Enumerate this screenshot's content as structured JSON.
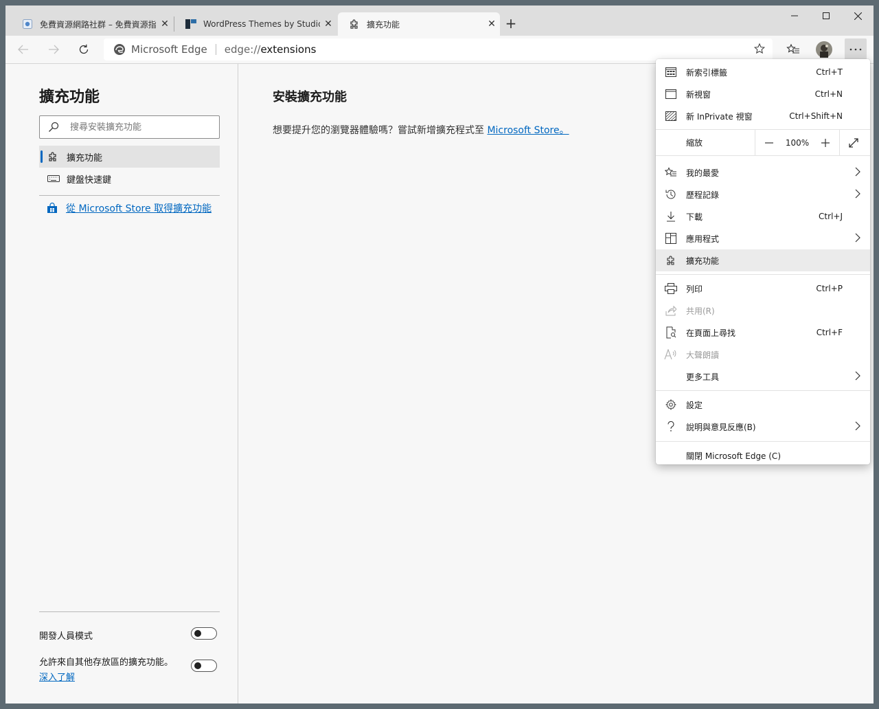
{
  "tabs": [
    {
      "title": "免費資源網路社群 – 免費資源指南"
    },
    {
      "title": "WordPress Themes by StudioPress"
    },
    {
      "title": "擴充功能"
    }
  ],
  "window_controls": {
    "minimize": "—",
    "maximize": "☐",
    "close": "✕"
  },
  "address": {
    "site": "Microsoft Edge",
    "url_prefix": "edge://",
    "url_main": "extensions"
  },
  "sidebar": {
    "title": "擴充功能",
    "search_placeholder": "搜尋安裝擴充功能",
    "items": [
      {
        "label": "擴充功能",
        "icon": "puzzle-icon",
        "active": true
      },
      {
        "label": "鍵盤快速鍵",
        "icon": "keyboard-icon",
        "active": false
      }
    ],
    "store_link": "從 Microsoft Store 取得擴充功能",
    "developer_mode_label": "開發人員模式",
    "developer_mode_on": false,
    "allow_other_stores_label": "允許來自其他存放區的擴充功能。",
    "learn_more": "深入了解",
    "allow_other_stores_on": false
  },
  "main": {
    "title": "安裝擴充功能",
    "desc": "想要提升您的瀏覽器體驗嗎？嘗試新增擴充程式至 ",
    "store_link": "Microsoft Store。"
  },
  "menu": {
    "new_tab": {
      "label": "新索引標籤",
      "shortcut": "Ctrl+T"
    },
    "new_window": {
      "label": "新視窗",
      "shortcut": "Ctrl+N"
    },
    "new_inprivate": {
      "label": "新 InPrivate 視窗",
      "shortcut": "Ctrl+Shift+N"
    },
    "zoom": {
      "label": "縮放",
      "value": "100%",
      "minus": "—",
      "plus": "+"
    },
    "favorites": {
      "label": "我的最愛"
    },
    "history": {
      "label": "歷程記錄"
    },
    "downloads": {
      "label": "下載",
      "shortcut": "Ctrl+J"
    },
    "apps": {
      "label": "應用程式"
    },
    "extensions": {
      "label": "擴充功能"
    },
    "print": {
      "label": "列印",
      "shortcut": "Ctrl+P"
    },
    "share": {
      "label": "共用(R)"
    },
    "find": {
      "label": "在頁面上尋找",
      "shortcut": "Ctrl+F"
    },
    "read_aloud": {
      "label": "大聲朗讀"
    },
    "more_tools": {
      "label": "更多工具"
    },
    "settings": {
      "label": "設定"
    },
    "help": {
      "label": "說明與意見反應(B)"
    },
    "close_edge": {
      "label": "關閉 Microsoft Edge (C)"
    }
  },
  "colors": {
    "accent": "#0067c0",
    "highlight": "#ebebeb"
  }
}
